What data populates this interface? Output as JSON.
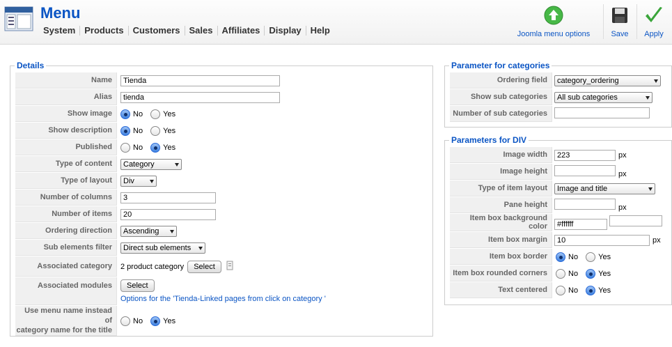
{
  "header": {
    "title": "Menu",
    "nav": [
      "System",
      "Products",
      "Customers",
      "Sales",
      "Affiliates",
      "Display",
      "Help"
    ],
    "toolbar": {
      "joomla_menu_options": "Joomla menu options",
      "save": "Save",
      "apply": "Apply"
    }
  },
  "details": {
    "legend": "Details",
    "name_label": "Name",
    "name_value": "Tienda",
    "alias_label": "Alias",
    "alias_value": "tienda",
    "show_image_label": "Show image",
    "show_description_label": "Show description",
    "published_label": "Published",
    "type_of_content_label": "Type of content",
    "type_of_content_value": "Category",
    "type_of_layout_label": "Type of layout",
    "type_of_layout_value": "Div",
    "number_of_columns_label": "Number of columns",
    "number_of_columns_value": "3",
    "number_of_items_label": "Number of items",
    "number_of_items_value": "20",
    "ordering_direction_label": "Ordering direction",
    "ordering_direction_value": "Ascending",
    "sub_elements_filter_label": "Sub elements filter",
    "sub_elements_filter_value": "Direct sub elements",
    "associated_category_label": "Associated category",
    "associated_category_value": "2 product category",
    "associated_modules_label": "Associated modules",
    "select_label": "Select",
    "options_link": "Options for the 'Tienda-Linked pages from click on category '",
    "use_menu_name_label_line1": "Use menu name instead of",
    "use_menu_name_label_line2": "category name for the title",
    "no": "No",
    "yes": "Yes"
  },
  "categories": {
    "legend": "Parameter for categories",
    "ordering_field_label": "Ordering field",
    "ordering_field_value": "category_ordering",
    "show_sub_categories_label": "Show sub categories",
    "show_sub_categories_value": "All sub categories",
    "number_of_sub_categories_label": "Number of sub categories",
    "number_of_sub_categories_value": ""
  },
  "div": {
    "legend": "Parameters for DIV",
    "image_width_label": "Image width",
    "image_width_value": "223",
    "image_height_label": "Image height",
    "image_height_value": "",
    "type_of_item_layout_label": "Type of item layout",
    "type_of_item_layout_value": "Image and title",
    "pane_height_label": "Pane height",
    "pane_height_value": "",
    "item_box_bg_label": "Item box background color",
    "item_box_bg_value": "#ffffff",
    "item_box_bg_value2": "",
    "item_box_margin_label": "Item box margin",
    "item_box_margin_value": "10",
    "item_box_border_label": "Item box border",
    "item_box_rounded_label": "Item box rounded corners",
    "text_centered_label": "Text centered",
    "px": "px",
    "no": "No",
    "yes": "Yes"
  },
  "colors": {
    "accent": "#0b55c4",
    "key_bg": "#f0f0f0",
    "apply_green": "#3aa53a",
    "options_green": "#47b847"
  }
}
